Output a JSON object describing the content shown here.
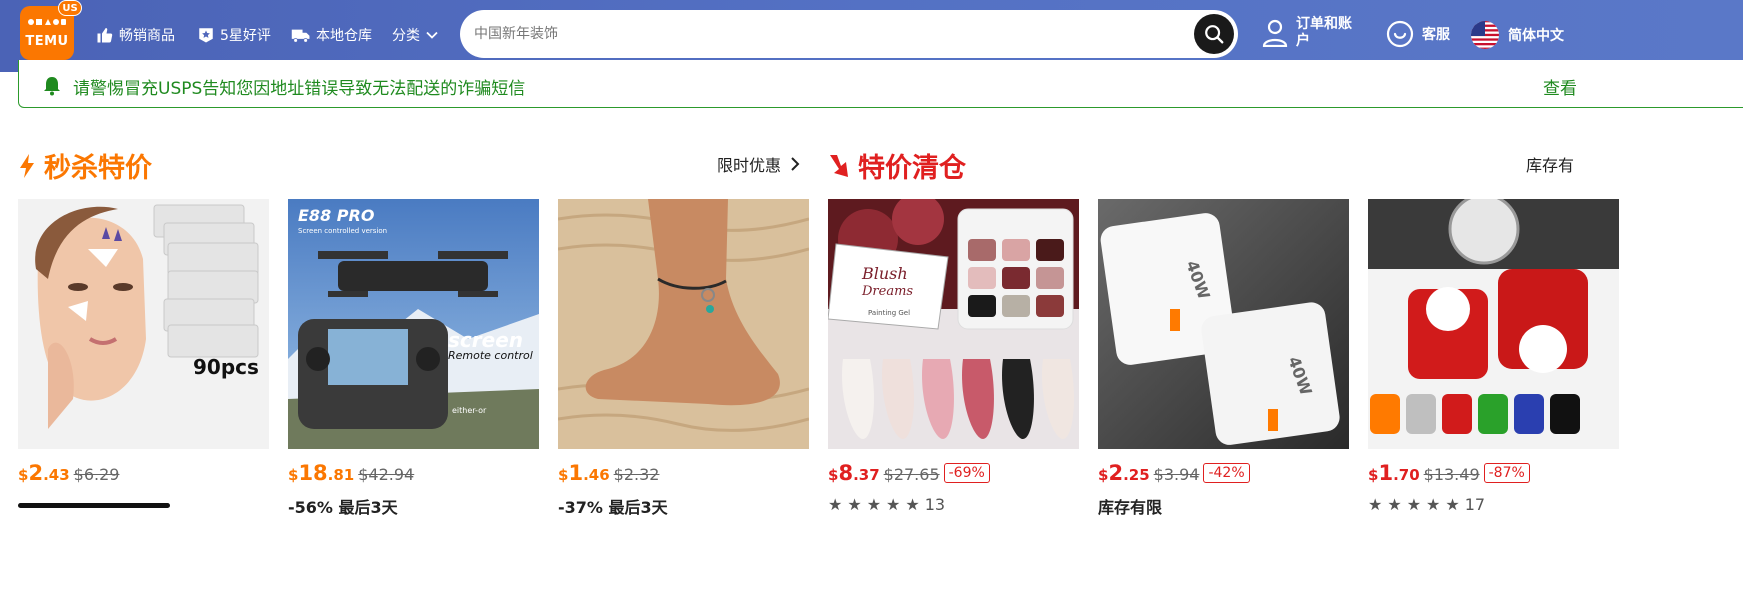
{
  "header": {
    "logo_text": "TEMU",
    "region_badge": "US",
    "nav": [
      {
        "label": "畅销商品",
        "icon": "thumbs-up-icon"
      },
      {
        "label": "5星好评",
        "icon": "star-badge-icon"
      },
      {
        "label": "本地仓库",
        "icon": "truck-icon"
      },
      {
        "label": "分类",
        "icon": "chevron-down-icon"
      }
    ],
    "search_placeholder": "中国新年装饰",
    "account_label": "订单和账户",
    "support_label": "客服",
    "language_label": "简体中文"
  },
  "notice": {
    "text": "请警惕冒充USPS告知您因地址错误导致无法配送的诈骗短信",
    "more": "查看"
  },
  "sections": [
    {
      "title": "秒杀特价",
      "link": "限时优惠",
      "color": "#fb7701",
      "icon": "lightning-icon"
    },
    {
      "title": "特价清仓",
      "link": "库存有",
      "color": "#e02020",
      "icon": "down-arrow-icon"
    }
  ],
  "products": [
    {
      "image": "forehead-patches",
      "image_text": "90pcs",
      "price_symbol": "$",
      "price_main": "2",
      "price_cents": ".43",
      "old_price": "$6.29",
      "discount": "",
      "subtitle": "",
      "rating_count": "",
      "progress": 0.9,
      "color": "orange"
    },
    {
      "image": "drone",
      "image_text": [
        "E88 PRO",
        "Screen controlled version",
        "screen",
        "Remote control",
        "either-or"
      ],
      "price_symbol": "$",
      "price_main": "18",
      "price_cents": ".81",
      "old_price": "$42.94",
      "discount": "",
      "subtitle": "-56% 最后3天",
      "rating_count": "",
      "color": "orange"
    },
    {
      "image": "anklet",
      "price_symbol": "$",
      "price_main": "1",
      "price_cents": ".46",
      "old_price": "$2.32",
      "discount": "",
      "subtitle": "-37% 最后3天",
      "rating_count": "",
      "color": "orange"
    },
    {
      "image": "nail-gel",
      "image_text": [
        "Blush",
        "Dreams",
        "Painting Gel"
      ],
      "price_symbol": "$",
      "price_main": "8",
      "price_cents": ".37",
      "old_price": "$27.65",
      "discount": "-69%",
      "subtitle": "",
      "rating_count": "13",
      "rating": 5,
      "color": "red"
    },
    {
      "image": "usb-charger",
      "image_text": "40W",
      "price_symbol": "$",
      "price_main": "2",
      "price_cents": ".25",
      "old_price": "$3.94",
      "discount": "-42%",
      "subtitle": "库存有限",
      "rating_count": "",
      "color": "red"
    },
    {
      "image": "valve-caps",
      "price_symbol": "$",
      "price_main": "1",
      "price_cents": ".70",
      "old_price": "$13.49",
      "discount": "-87%",
      "subtitle": "",
      "rating_count": "17",
      "rating": 5,
      "color": "red"
    }
  ]
}
